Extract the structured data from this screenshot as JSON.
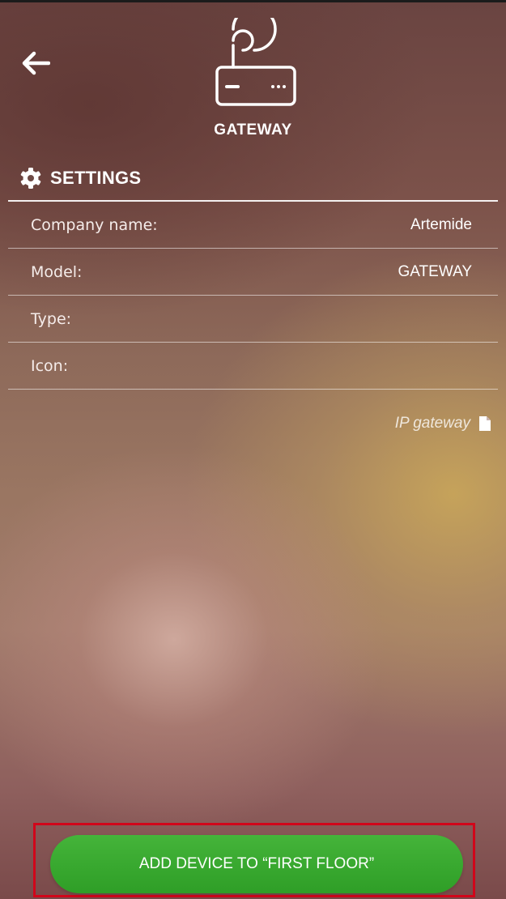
{
  "header": {
    "back_icon": "arrow-left-icon",
    "device_icon": "router-icon",
    "device_title": "GATEWAY"
  },
  "settings": {
    "icon": "gear-icon",
    "title": "SETTINGS",
    "rows": [
      {
        "label": "Company name:",
        "value": "Artemide"
      },
      {
        "label": "Model:",
        "value": "GATEWAY"
      },
      {
        "label": "Type:",
        "value": ""
      },
      {
        "label": "Icon:",
        "value": ""
      }
    ]
  },
  "document_link": {
    "label": "IP gateway",
    "icon": "document-icon"
  },
  "action": {
    "add_button_label": "ADD DEVICE TO “FIRST FLOOR”",
    "button_color": "#3aa831",
    "highlight_color": "#d1061a"
  }
}
